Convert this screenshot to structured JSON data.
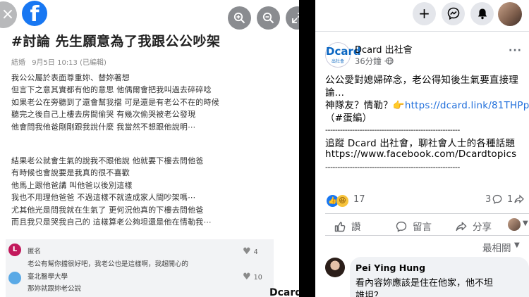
{
  "viewer": {
    "close_glyph": "×",
    "logo_letter": "f",
    "buttons": [
      "zoom-in",
      "zoom-out",
      "fullscreen"
    ]
  },
  "image_post": {
    "title": "#討論 先生願意為了我跟公公吵架",
    "meta": {
      "board": "結婚",
      "date": "9月5日 10:13 (已編輯)"
    },
    "paragraph1": [
      "我公公屬於表面尊重妳、替妳著想",
      "但言下之意其實都有他的意思 他偶爾會把我叫過去碎碎唸",
      "如果老公在旁聽到了還會幫我擋 可是還是有老公不在的時候",
      "聽完之後自己上樓去房間偷哭 有幾次偷哭被老公發現",
      "他會問我他爸剛剛跟我說什麼 我當然不想跟他說明⋯"
    ],
    "paragraph2": [
      "結果老公就會生氣的說我不跟他說 他就要下樓去問他爸",
      "有時候也會說要是我真的很不喜歡",
      "他馬上跟他爸講 叫他爸以後別這樣",
      "我也不用理他爸爸 不過這樣不就造成家人間吵架嗎⋯",
      "尤其他光是問我就在生氣了 更何況他真的下樓去問他爸",
      "而且我只是哭我自己的 這樣算老公夠坦還是他在情勒我⋯"
    ],
    "comments": [
      {
        "avatar_letter": "L",
        "name": "匿名",
        "text": "老公有幫你擋很好吧，我老公也是這樣啊，我超開心的",
        "likes": "4"
      },
      {
        "avatar_letter": "",
        "name": "臺北醫學大學",
        "text": "那妳就跟妳老公說",
        "likes": "10"
      }
    ],
    "watermark": "Dcard"
  },
  "topbar": {
    "plus": "+",
    "buttons": [
      "create-plus",
      "messenger",
      "notifications"
    ]
  },
  "post": {
    "page_name": "Dcard 出社會",
    "avatar_text": "Dcard",
    "avatar_sub": "出社會",
    "time": "36分鐘 ·",
    "more": "···",
    "text_line1": "公公愛對媳婦碎念，老公得知後生氣要直接理",
    "text_line2": "論...",
    "text_line3_prefix": "神隊友？情勒？👉",
    "link": "https://dcard.link/81THPp",
    "text_line4": "（#蛋編）",
    "rule": "-------------------------------------------------------",
    "promo_line": "追蹤 Dcard 出社會，聊社會人士的各種話題",
    "promo_url": "https://www.facebook.com/Dcardtopics",
    "reaction_count": "17",
    "comment_count": "3",
    "share_count": "1",
    "actions": {
      "like": "讚",
      "comment": "留言",
      "share": "分享"
    },
    "sort_label": "最相關"
  },
  "comment": {
    "name": "Pei Ying Hung",
    "line1": "看內容妳應該是住在他家，他不坦",
    "line2": "誰坦？"
  },
  "colors": {
    "facebook_blue": "#1877f2",
    "link": "#216fdb",
    "secondary_text": "#65676b"
  }
}
